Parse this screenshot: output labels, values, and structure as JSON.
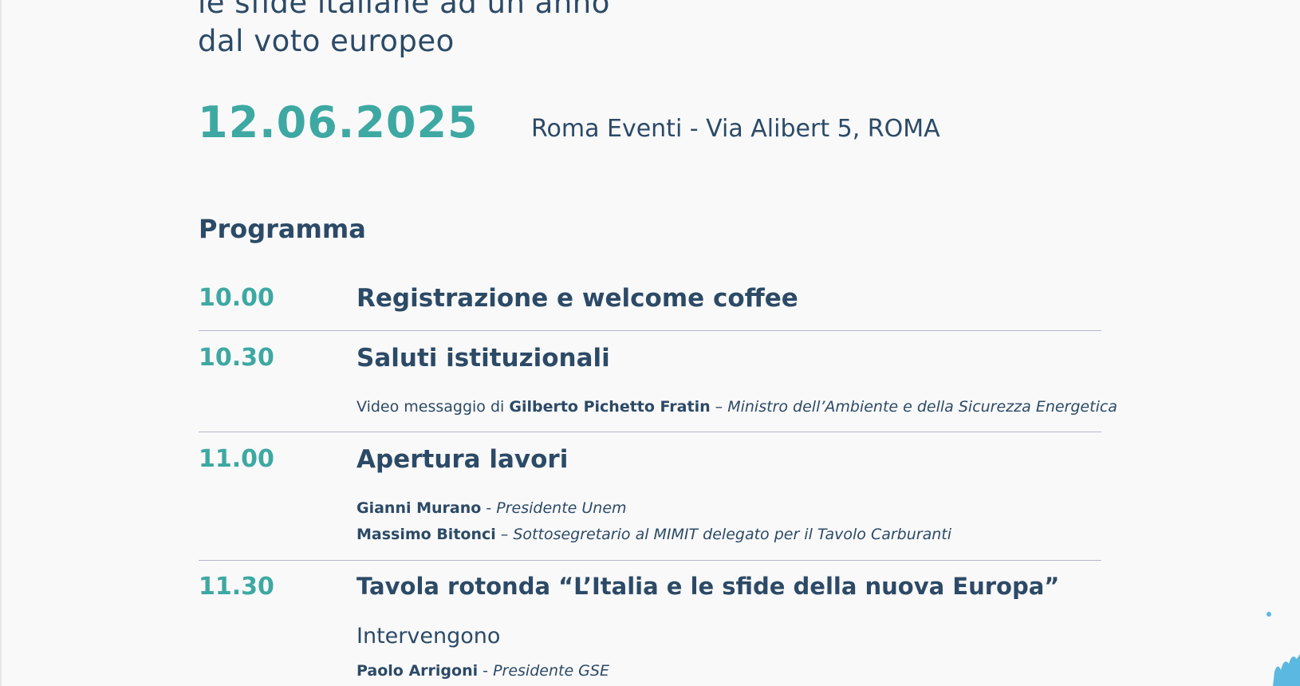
{
  "header": {
    "title_line1": "le sfide italiane ad un anno",
    "title_line2": "dal voto europeo",
    "date": "12.06.2025",
    "venue": "Roma Eventi - Via Alibert 5, ROMA"
  },
  "program": {
    "heading": "Programma",
    "items": [
      {
        "time": "10.00",
        "title": "Registrazione e welcome coffee"
      },
      {
        "time": "10.30",
        "title": "Saluti istituzionali",
        "speakers": [
          {
            "prefix": "Video messaggio di ",
            "name": "Gilberto Pichetto Fratin",
            "sep": " – ",
            "role": "Ministro dell’Ambiente e della Sicurezza Energetica"
          }
        ]
      },
      {
        "time": "11.00",
        "title": "Apertura lavori",
        "speakers": [
          {
            "name": "Gianni Murano",
            "sep": " - ",
            "role": "Presidente Unem"
          },
          {
            "name": "Massimo Bitonci",
            "sep": " – ",
            "role": "Sottosegretario al MIMIT delegato per il Tavolo Carburanti"
          }
        ]
      },
      {
        "time": "11.30",
        "title": "Tavola rotonda “L’Italia e le sfide della nuova Europa”",
        "intro": "Intervengono",
        "speakers": [
          {
            "name": "Paolo Arrigoni",
            "sep": " - ",
            "role": "Presidente GSE"
          }
        ]
      }
    ]
  }
}
